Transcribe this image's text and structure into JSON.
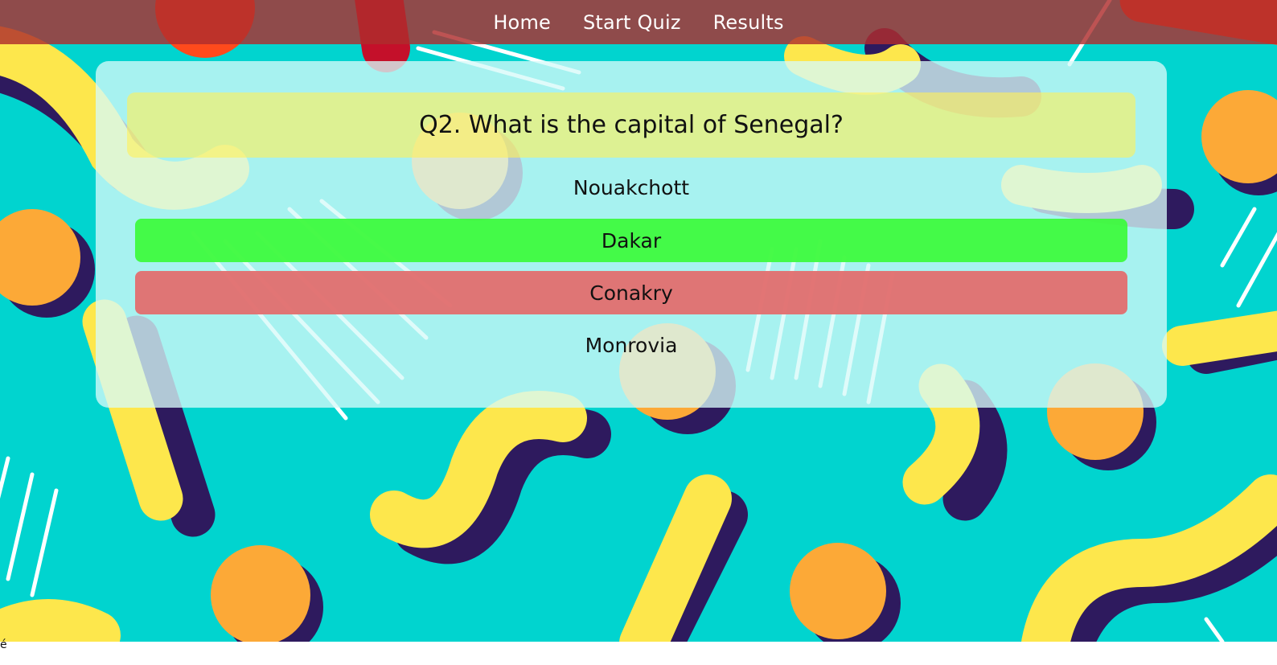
{
  "nav": {
    "items": [
      {
        "label": "Home"
      },
      {
        "label": "Start Quiz"
      },
      {
        "label": "Results"
      }
    ]
  },
  "quiz": {
    "question": "Q2. What is the capital of Senegal?",
    "answers": [
      {
        "label": "Nouakchott",
        "state": "neutral"
      },
      {
        "label": "Dakar",
        "state": "correct"
      },
      {
        "label": "Conakry",
        "state": "wrong"
      },
      {
        "label": "Monrovia",
        "state": "neutral"
      }
    ]
  },
  "footer": {
    "char": "é"
  },
  "colors": {
    "background": "#01d4cf",
    "navbar": "#af2d2d",
    "correct": "#3efa3e",
    "wrong": "#e26e6e",
    "question_box": "#fff05a",
    "card": "#d6faf9"
  }
}
